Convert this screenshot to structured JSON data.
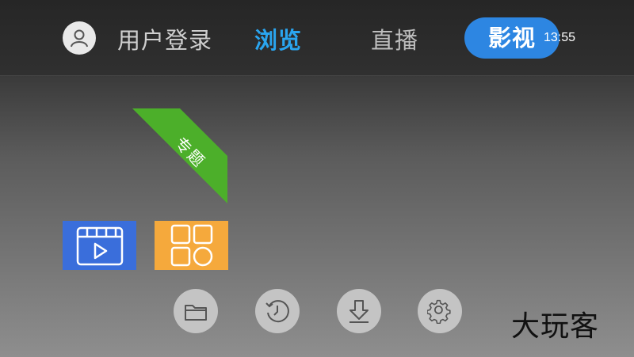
{
  "header": {
    "login_label": "用户登录",
    "tabs": [
      {
        "label": "浏览",
        "state": "highlighted"
      },
      {
        "label": "直播",
        "state": "normal"
      },
      {
        "label": "影视",
        "state": "selected"
      }
    ],
    "clock": "13:55"
  },
  "ribbon": {
    "label": "专题",
    "color": "#4caf2a"
  },
  "tiles": [
    {
      "icon": "video-clapper-icon",
      "color": "#3a6edb"
    },
    {
      "icon": "apps-grid-icon",
      "color": "#f5a93c"
    }
  ],
  "toolbar": {
    "buttons": [
      {
        "icon": "folder-icon"
      },
      {
        "icon": "history-clock-icon"
      },
      {
        "icon": "download-icon"
      },
      {
        "icon": "settings-gear-icon"
      }
    ]
  },
  "watermark": "大玩客",
  "colors": {
    "accent_blue": "#2aa5ef",
    "selected_pill": "#2d86e2"
  }
}
